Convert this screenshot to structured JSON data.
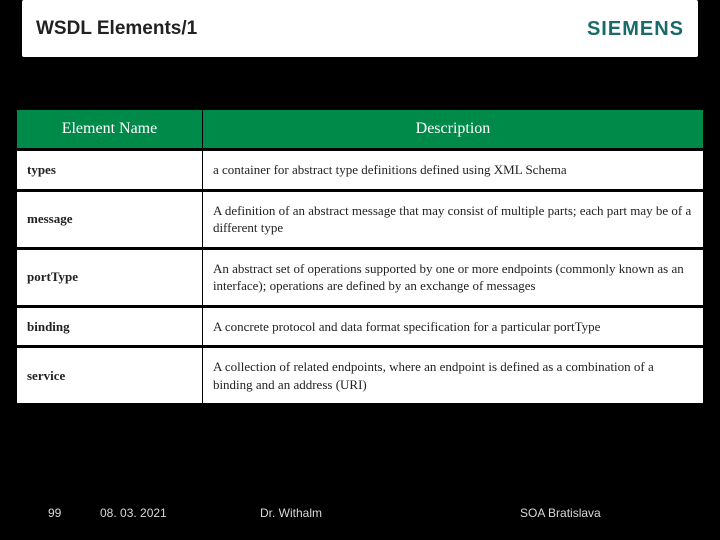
{
  "header": {
    "title": "WSDL Elements/1",
    "logo": "SIEMENS"
  },
  "table": {
    "headers": {
      "col1": "Element Name",
      "col2": "Description"
    },
    "rows": [
      {
        "name": "types",
        "desc": "a container for abstract type definitions defined using XML Schema"
      },
      {
        "name": "message",
        "desc": "A definition of an abstract message that may consist of multiple parts; each part may be of a different type"
      },
      {
        "name": "portType",
        "desc": "An abstract set of operations supported by one or more endpoints (commonly known as an interface); operations are defined by an exchange of messages"
      },
      {
        "name": "binding",
        "desc": "A concrete protocol and data format specification for a particular portType"
      },
      {
        "name": "service",
        "desc": "A collection of related endpoints, where an endpoint is defined as a combination of a binding and an address (URI)"
      }
    ]
  },
  "footer": {
    "page": "99",
    "date": "08. 03. 2021",
    "author": "Dr. Withalm",
    "place": "SOA Bratislava"
  }
}
